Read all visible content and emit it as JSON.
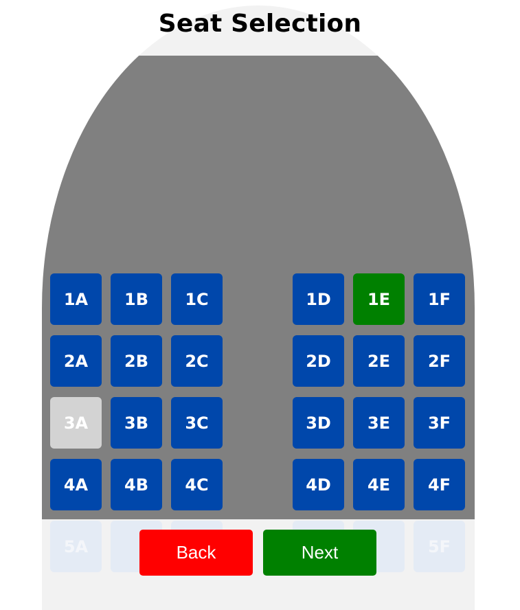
{
  "title": "Seat Selection",
  "colors": {
    "available": "#0047ab",
    "selected": "#008000",
    "occupied": "#d3d3d3",
    "cabin": "#808080",
    "back_button": "#ff0000",
    "next_button": "#008000"
  },
  "seats": {
    "1A": {
      "label": "1A",
      "status": "available"
    },
    "1B": {
      "label": "1B",
      "status": "available"
    },
    "1C": {
      "label": "1C",
      "status": "available"
    },
    "1D": {
      "label": "1D",
      "status": "available"
    },
    "1E": {
      "label": "1E",
      "status": "selected"
    },
    "1F": {
      "label": "1F",
      "status": "available"
    },
    "2A": {
      "label": "2A",
      "status": "available"
    },
    "2B": {
      "label": "2B",
      "status": "available"
    },
    "2C": {
      "label": "2C",
      "status": "available"
    },
    "2D": {
      "label": "2D",
      "status": "available"
    },
    "2E": {
      "label": "2E",
      "status": "available"
    },
    "2F": {
      "label": "2F",
      "status": "available"
    },
    "3A": {
      "label": "3A",
      "status": "occupied"
    },
    "3B": {
      "label": "3B",
      "status": "available"
    },
    "3C": {
      "label": "3C",
      "status": "available"
    },
    "3D": {
      "label": "3D",
      "status": "available"
    },
    "3E": {
      "label": "3E",
      "status": "available"
    },
    "3F": {
      "label": "3F",
      "status": "available"
    },
    "4A": {
      "label": "4A",
      "status": "available"
    },
    "4B": {
      "label": "4B",
      "status": "available"
    },
    "4C": {
      "label": "4C",
      "status": "available"
    },
    "4D": {
      "label": "4D",
      "status": "available"
    },
    "4E": {
      "label": "4E",
      "status": "available"
    },
    "4F": {
      "label": "4F",
      "status": "available"
    },
    "5A": {
      "label": "5A"
    },
    "5F": {
      "label": "5F"
    }
  },
  "buttons": {
    "back_label": "Back",
    "next_label": "Next"
  }
}
